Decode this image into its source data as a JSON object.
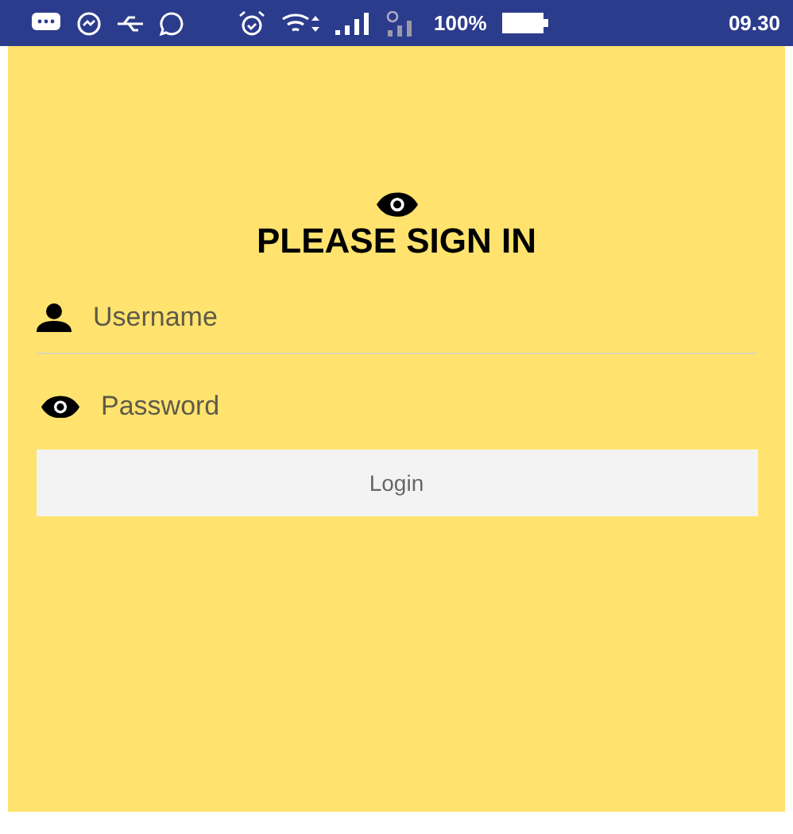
{
  "status_bar": {
    "battery": "100%",
    "time": "09.30"
  },
  "title": "PLEASE SIGN IN",
  "fields": [
    {
      "kind": "username",
      "placeholder": "Username"
    },
    {
      "kind": "password",
      "placeholder": "Password"
    }
  ],
  "button": "Login"
}
